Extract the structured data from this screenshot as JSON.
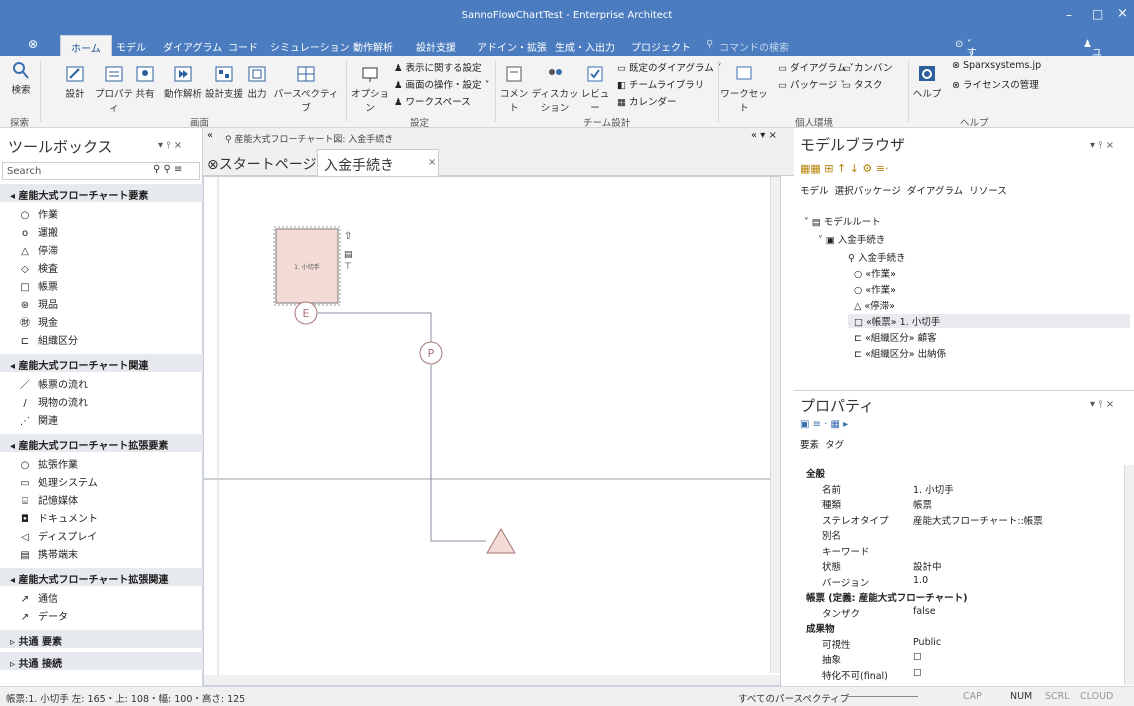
{
  "window": {
    "title": "SannoFlowChartTest - Enterprise Architect",
    "minimize": "–",
    "maximize": "□",
    "close": "×"
  },
  "menu": {
    "items": [
      "ホーム",
      "モデル",
      "ダイアグラム",
      "コード",
      "シミュレーション",
      "動作解析",
      "設計支援",
      "アドイン・拡張",
      "生成・入出力",
      "プロジェクト"
    ],
    "search": "コマンドの検索",
    "perspective": "すべてのパースペクティブ",
    "user": "ユーザー"
  },
  "ribbon": {
    "big": [
      "検索",
      "設計",
      "プロパティ",
      "共有",
      "動作解析",
      "設計支援",
      "出力",
      "パースペクティブ",
      "オプション",
      "コメント",
      "ディスカッション",
      "レビュー",
      "ワークセット",
      "ヘルプ"
    ],
    "small": [
      "表示に関する設定",
      "画面の操作・設定",
      "ワークスペース",
      "既定のダイアグラム",
      "チームライブラリ",
      "カレンダー",
      "ダイアグラム",
      "カンバン",
      "パッケージ",
      "タスク",
      "Sparxsystems.jp",
      "ライセンスの管理"
    ],
    "groups": [
      "探索",
      "画面",
      "設定",
      "チーム設計",
      "個人環境",
      "ヘルプ"
    ]
  },
  "toolbox": {
    "title": "ツールボックス",
    "search_placeholder": "Search",
    "sections": [
      {
        "title": "産能大式フローチャート要素",
        "items": [
          [
            "○",
            "作業"
          ],
          [
            "o",
            "運搬"
          ],
          [
            "△",
            "停滞"
          ],
          [
            "◇",
            "検査"
          ],
          [
            "□",
            "帳票"
          ],
          [
            "⊛",
            "現品"
          ],
          [
            "㊖",
            "現金"
          ],
          [
            "⊏",
            "組織区分"
          ]
        ]
      },
      {
        "title": "産能大式フローチャート関連",
        "items": [
          [
            "／",
            "帳票の流れ"
          ],
          [
            "/",
            "現物の流れ"
          ],
          [
            "⋰",
            "関連"
          ]
        ]
      },
      {
        "title": "産能大式フローチャート拡張要素",
        "items": [
          [
            "○",
            "拡張作業"
          ],
          [
            "▭",
            "処理システム"
          ],
          [
            "⌸",
            "記憶媒体"
          ],
          [
            "◘",
            "ドキュメント"
          ],
          [
            "◁",
            "ディスプレイ"
          ],
          [
            "▤",
            "携帯端末"
          ]
        ]
      },
      {
        "title": "産能大式フローチャート拡張関連",
        "items": [
          [
            "↗",
            "通信"
          ],
          [
            "↗",
            "データ"
          ]
        ]
      },
      {
        "title": "共通 要素",
        "items": []
      },
      {
        "title": "共通 接続",
        "items": []
      }
    ]
  },
  "doc": {
    "path": "産能大式フローチャート図: 入金手続き",
    "tabs": [
      "スタートページ",
      "入金手続き"
    ],
    "close": "×",
    "node_label": "1. 小切手",
    "e_label": "E",
    "p_label": "P"
  },
  "browser": {
    "title": "モデルブラウザ",
    "tabs": [
      "モデル",
      "選択パッケージ",
      "ダイアグラム",
      "リソース"
    ],
    "tree": [
      "モデルルート",
      "入金手続き",
      "入金手続き",
      "«作業»",
      "«作業»",
      "«停滞»",
      "«帳票» 1. 小切手",
      "«組織区分» 顧客",
      "«組織区分» 出納係"
    ]
  },
  "props": {
    "title": "プロパティ",
    "tabs": [
      "要素",
      "タグ"
    ],
    "rows": [
      [
        "全般",
        ""
      ],
      [
        "名前",
        "1. 小切手"
      ],
      [
        "種類",
        "帳票"
      ],
      [
        "ステレオタイプ",
        "産能大式フローチャート::帳票"
      ],
      [
        "別名",
        ""
      ],
      [
        "キーワード",
        ""
      ],
      [
        "状態",
        "設計中"
      ],
      [
        "バージョン",
        "1.0"
      ],
      [
        "帳票 (定義: 産能大式フローチャート)",
        ""
      ],
      [
        "タンザク",
        "false"
      ],
      [
        "成果物",
        ""
      ],
      [
        "可視性",
        "Public"
      ],
      [
        "抽象",
        "☐"
      ],
      [
        "特化不可(final)",
        "☐"
      ]
    ]
  },
  "status": {
    "left": "帳票:1. 小切手 左: 165・上: 108・幅: 100・高さ: 125",
    "perspective": "すべてのパースペクティブ",
    "cap": "CAP",
    "num": "NUM",
    "scrl": "SCRL",
    "cloud": "CLOUD"
  }
}
